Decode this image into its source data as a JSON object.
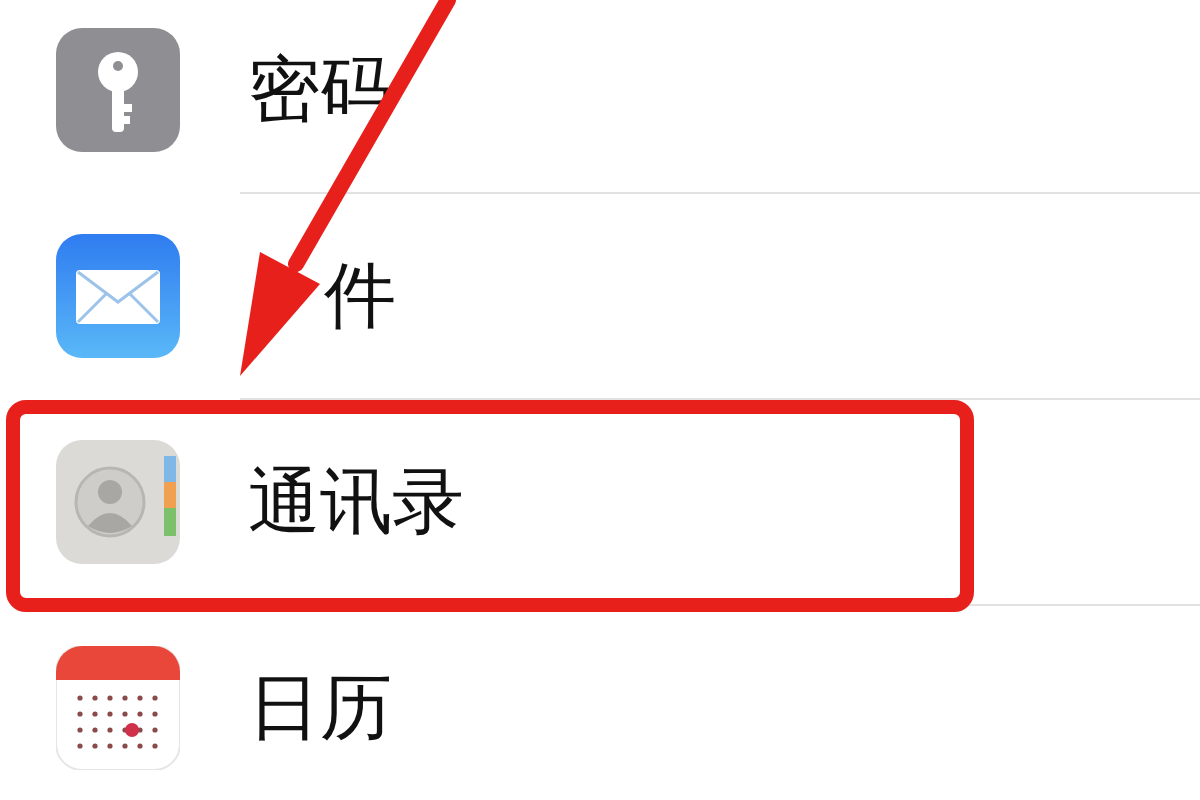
{
  "settings_list": [
    {
      "label": "密码",
      "highlighted": false
    },
    {
      "label": "件",
      "highlighted": false
    },
    {
      "label": "通讯录",
      "highlighted": true
    },
    {
      "label": "日历",
      "highlighted": false
    }
  ]
}
